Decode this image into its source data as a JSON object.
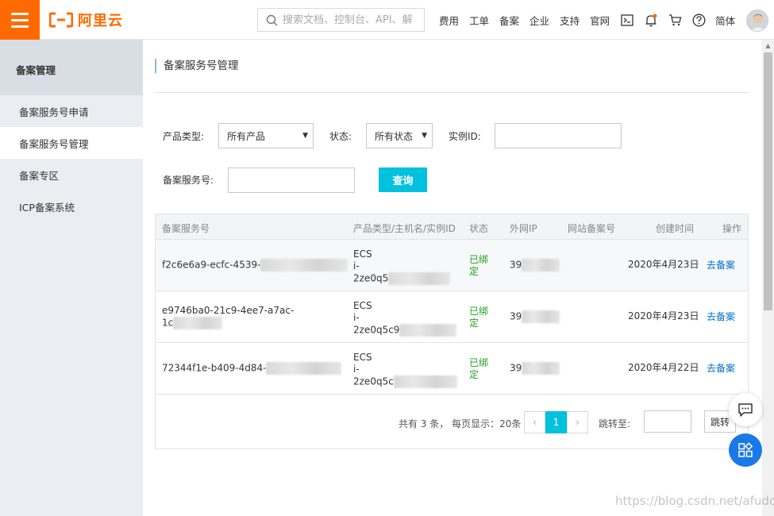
{
  "colors": {
    "brand": "#ff6a00",
    "accent": "#00c1de",
    "link": "#0070cc",
    "status_green": "#1fa11f",
    "fab_blue": "#1979e6"
  },
  "header": {
    "logo_text": "阿里云",
    "search_placeholder": "搜索文档、控制台、API、解",
    "nav": [
      "费用",
      "工单",
      "备案",
      "企业",
      "支持",
      "官网"
    ],
    "lang": "简体",
    "icons": [
      "terminal-icon",
      "bell-icon",
      "cart-icon",
      "help-icon"
    ]
  },
  "sidebar": {
    "title": "备案管理",
    "items": [
      {
        "label": "备案服务号申请"
      },
      {
        "label": "备案服务号管理"
      },
      {
        "label": "备案专区"
      },
      {
        "label": "ICP备案系统"
      }
    ]
  },
  "main": {
    "title": "备案服务号管理",
    "filters": {
      "product_type_label": "产品类型:",
      "product_type_value": "所有产品",
      "status_label": "状态:",
      "status_value": "所有状态",
      "instance_label": "实例ID:",
      "service_no_label": "备案服务号:",
      "query_button": "查询"
    },
    "table": {
      "headers": [
        "备案服务号",
        "产品类型/主机名/实例ID",
        "状态",
        "外网IP",
        "网站备案号",
        "创建时间",
        "操作"
      ],
      "rows": [
        {
          "service_no": "f2c6e6a9-ecfc-4539-",
          "product": "ECS",
          "host": "i-",
          "instance": "2ze0q5",
          "status_line1": "已绑",
          "status_line2": "定",
          "ip": "39",
          "site_no": "",
          "created": "2020年4月23日",
          "action": "去备案"
        },
        {
          "service_no": "e9746ba0-21c9-4ee7-a7ac-",
          "service_no_2": "1c",
          "product": "ECS",
          "host": "i-",
          "instance": "2ze0q5c9",
          "status_line1": "已绑",
          "status_line2": "定",
          "ip": "39",
          "site_no": "",
          "created": "2020年4月23日",
          "action": "去备案"
        },
        {
          "service_no": "72344f1e-b409-4d84-",
          "product": "ECS",
          "host": "i-",
          "instance": "2ze0q5c",
          "status_line1": "已绑",
          "status_line2": "定",
          "ip": "39",
          "site_no": "",
          "created": "2020年4月22日",
          "action": "去备案"
        }
      ]
    },
    "pagination": {
      "total_text": "共有 3 条，  每页显示：20条",
      "prev": "‹",
      "current": "1",
      "next": "›",
      "jump_label": "跳转至:",
      "jump_button": "跳转"
    }
  },
  "watermark": "https://blog.csdn.net/afudos"
}
